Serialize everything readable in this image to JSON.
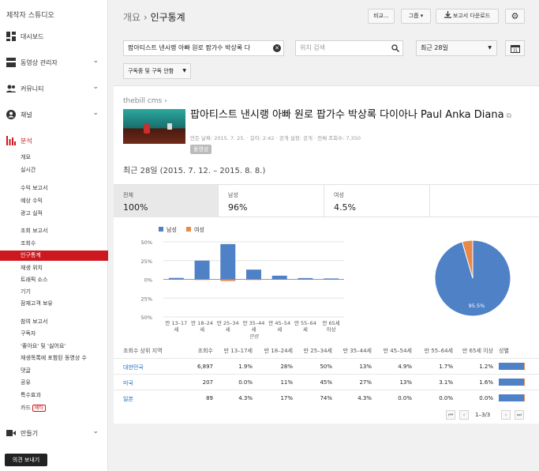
{
  "sidebar": {
    "studio": "제작자 스튜디오",
    "nav": {
      "dashboard": "대시보드",
      "videos": "동영상 관리자",
      "community": "커뮤니티",
      "channel": "채널",
      "analytics": "분석",
      "create": "만들기"
    },
    "sub": [
      "개요",
      "실시간",
      "수익 보고서",
      "예상 수익",
      "광고 실적",
      "조회 보고서",
      "조회수",
      "인구통계",
      "재생 위치",
      "트래픽 소스",
      "기기",
      "잠재고객 보유",
      "참여 보고서",
      "구독자",
      "'좋아요' 및 '싫어요'",
      "재생목록에 포함된 동영상 수",
      "댓글",
      "공유",
      "특수효과",
      "카드"
    ],
    "beta": "베타",
    "feedback": "의견 보내기"
  },
  "header": {
    "crumb_parent": "개요",
    "crumb_sep": "›",
    "crumb_current": "인구통계",
    "compare": "비교...",
    "group": "그룹 ▾",
    "download": "보고서 다운로드"
  },
  "filters": {
    "content": "팝아티스트 낸시랭 아빠 원로 팝가수 박상록 다",
    "location_placeholder": "위치 검색",
    "period": "최근 28일",
    "subscription": "구독중 및 구독 안함"
  },
  "video": {
    "channel": "thebill cms ›",
    "title": "팝아티스트 낸시랭 아빠 원로 팝가수 박상록 다이아나 Paul Anka Diana",
    "meta": "만든 날짜: 2015. 7. 25. · 길이: 2:42 · 공개 설정: 공개 · 전체 조회수: 7,350",
    "badge": "동영상"
  },
  "period_label": "최근 28일 (2015. 7. 12. – 2015. 8. 8.)",
  "tiles": [
    {
      "label": "전체",
      "value": "100%"
    },
    {
      "label": "남성",
      "value": "96%"
    },
    {
      "label": "여성",
      "value": "4.5%"
    }
  ],
  "colors": {
    "male": "#4f81c7",
    "female": "#e8894b",
    "accent": "#cc181e"
  },
  "chart_data": [
    {
      "type": "bar",
      "legend": [
        "남성",
        "여성"
      ],
      "categories": [
        "만 13–17세",
        "만 18–24세",
        "만 25–34세",
        "만 35–44세",
        "만 45–54세",
        "만 55–64세",
        "만 65세 이상"
      ],
      "series": [
        {
          "name": "남성",
          "values": [
            1.9,
            25,
            47,
            13,
            4.9,
            1.7,
            1.2
          ]
        },
        {
          "name": "여성",
          "values": [
            0,
            0.8,
            2.2,
            0.3,
            0,
            0,
            0
          ]
        }
      ],
      "ylim": [
        -50,
        50
      ],
      "yticks": [
        "50%",
        "25%",
        "0%",
        "25%",
        "50%"
      ],
      "xlabel": "연령"
    },
    {
      "type": "pie",
      "slices": [
        {
          "name": "남성",
          "value": 95.5
        },
        {
          "name": "여성",
          "value": 4.5
        }
      ],
      "label": "95.5%"
    }
  ],
  "table": {
    "headers": [
      "조회수 상위 지역",
      "조회수",
      "만 13–17세",
      "만 18–24세",
      "만 25–34세",
      "만 35–44세",
      "만 45–54세",
      "만 55–64세",
      "만 65세 이상",
      "성별"
    ],
    "rows": [
      {
        "cells": [
          "대한민국",
          "6,897",
          "1.9%",
          "28%",
          "50%",
          "13%",
          "4.9%",
          "1.7%",
          "1.2%"
        ],
        "male": 0.96
      },
      {
        "cells": [
          "미국",
          "207",
          "0.0%",
          "11%",
          "45%",
          "27%",
          "13%",
          "3.1%",
          "1.6%"
        ],
        "male": 0.96
      },
      {
        "cells": [
          "일본",
          "89",
          "4.3%",
          "17%",
          "74%",
          "4.3%",
          "0.0%",
          "0.0%",
          "0.0%"
        ],
        "male": 0.96
      }
    ],
    "pager": "1–3/3"
  }
}
